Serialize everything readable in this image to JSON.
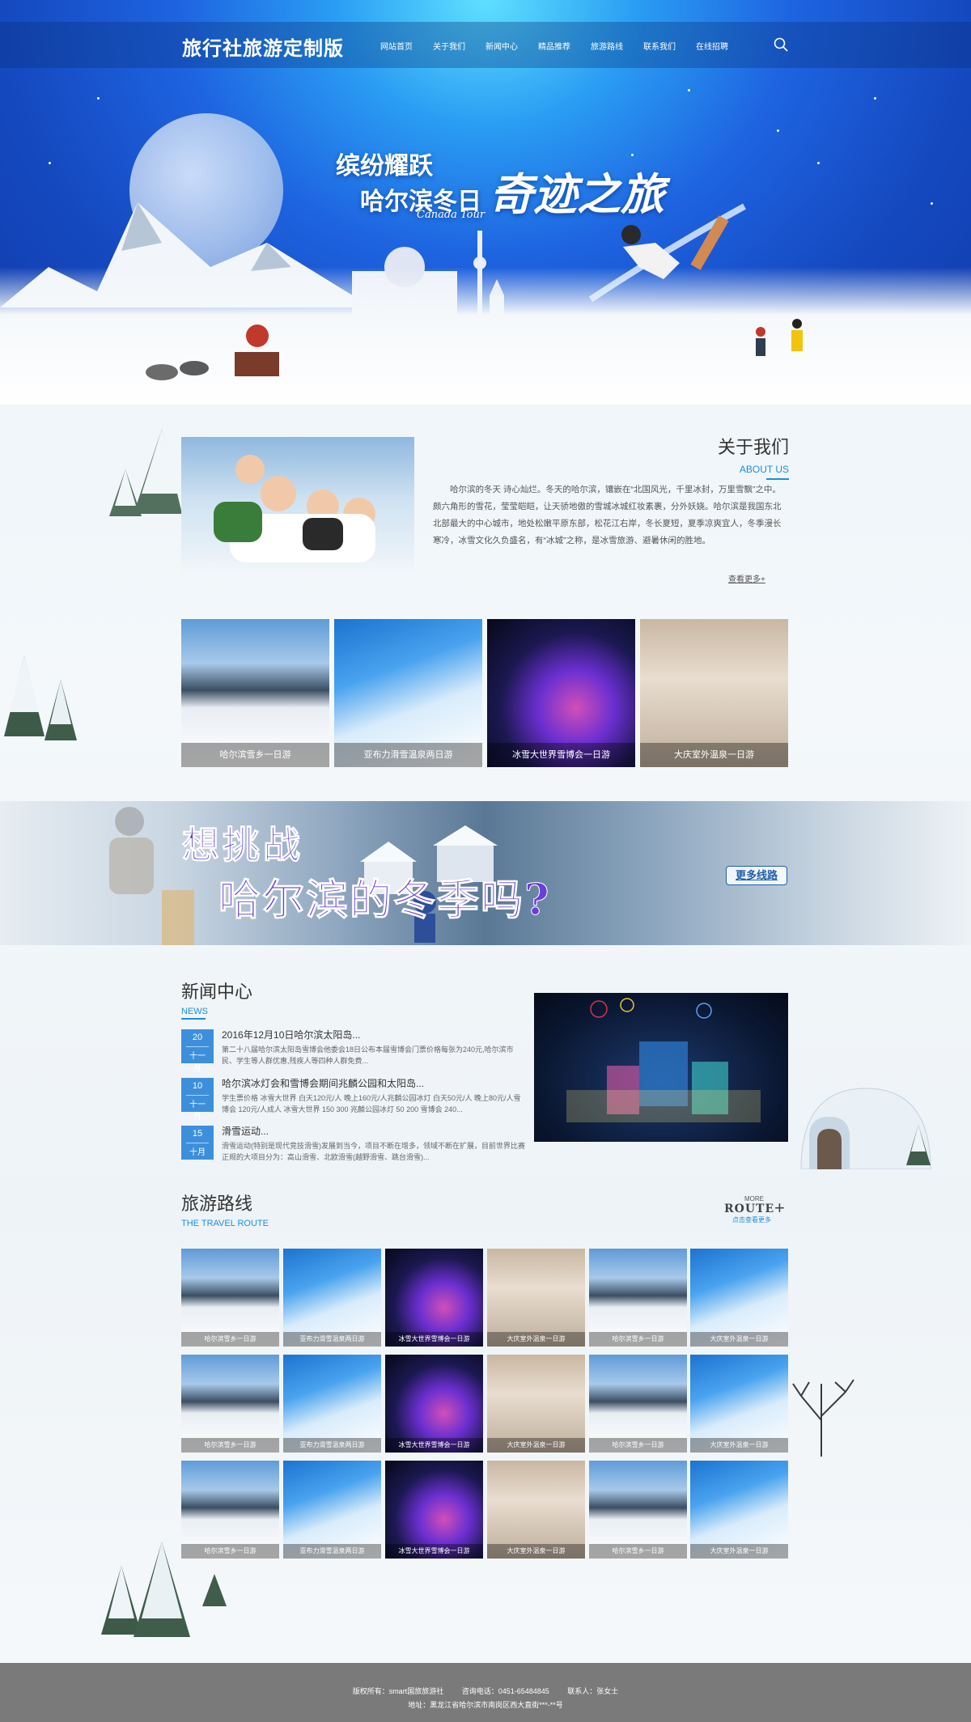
{
  "nav": {
    "brand": "旅行社旅游定制版",
    "items": [
      "网站首页",
      "关于我们",
      "新闻中心",
      "精品推荐",
      "旅游路线",
      "联系我们",
      "在线招聘"
    ]
  },
  "hero": {
    "line1": "缤纷耀跃",
    "line2": "哈尔滨冬日",
    "line3": "奇迹之旅",
    "line4": "Canada Tour"
  },
  "about": {
    "title": "关于我们",
    "subtitle": "ABOUT US",
    "text": "哈尔滨的冬天 诗心灿烂。冬天的哈尔滨，镶嵌在“北国风光，千里冰封，万里雪飘”之中。颇六角形的雪花，莹莹皑皑，让天骄地傲的雪城冰城红妆素裹，分外妖娆。哈尔滨是我国东北北部最大的中心城市，地处松嫩平原东部，松花江右岸，冬长夏短，夏季凉爽宜人，冬季漫长寒冷，冰雪文化久负盛名，有“冰城”之称，是冰雪旅游、避暑休闲的胜地。",
    "more": "查看更多+"
  },
  "features": [
    {
      "label": "哈尔滨雪乡一日游"
    },
    {
      "label": "亚布力滑雪温泉两日游"
    },
    {
      "label": "冰雪大世界雪博会一日游"
    },
    {
      "label": "大庆室外温泉一日游"
    }
  ],
  "banner": {
    "line1": "想挑战",
    "line2": "哈尔滨的冬季吗?",
    "button": "更多线路"
  },
  "news": {
    "title": "新闻中心",
    "subtitle": "NEWS",
    "items": [
      {
        "day": "20",
        "month": "十一月",
        "title": "2016年12月10日哈尔滨太阳岛...",
        "desc": "第二十八届哈尔滨太阳岛雪博会他委会18日公布本届雪博会门票价格每张为240元,哈尔滨市民、学生等人群优惠,残疾人等四种人群免费..."
      },
      {
        "day": "10",
        "month": "十一月",
        "title": "哈尔滨冰灯会和雪博会期间兆麟公园和太阳岛...",
        "desc": "学生票价格 冰雪大世界 白天120元/人 晚上160元/人兆麟公园冰灯 白天50元/人 晚上80元/人雪博会 120元/人成人 冰雪大世界 150 300 兆麟公园冰灯 50 200 雪博会 240..."
      },
      {
        "day": "15",
        "month": "十月",
        "title": "滑雪运动...",
        "desc": "滑雪运动(特别是现代竞技滑雪)发展到当今，项目不断在增多，领域不断在扩展，目前世界比赛正规的大项目分为：高山滑雪、北欧滑雪(越野滑雪、跳台滑雪)..."
      }
    ]
  },
  "route": {
    "title": "旅游路线",
    "subtitle": "THE TRAVEL ROUTE",
    "more_small": "MORE",
    "more_big": "ROUTE",
    "more_sub": "点击查看更多",
    "rows": [
      [
        "哈尔滨雪乡一日游",
        "亚布力滑雪温泉两日游",
        "冰雪大世界雪博会一日游",
        "大庆室外温泉一日游",
        "哈尔滨雪乡一日游",
        "大庆室外温泉一日游"
      ],
      [
        "哈尔滨雪乡一日游",
        "亚布力滑雪温泉两日游",
        "冰雪大世界雪博会一日游",
        "大庆室外温泉一日游",
        "哈尔滨雪乡一日游",
        "大庆室外温泉一日游"
      ],
      [
        "哈尔滨雪乡一日游",
        "亚布力滑雪温泉两日游",
        "冰雪大世界雪博会一日游",
        "大庆室外温泉一日游",
        "哈尔滨雪乡一日游",
        "大庆室外温泉一日游"
      ]
    ]
  },
  "footer": {
    "copyright": "版权所有：smart国旅旅游社",
    "phone": "咨询电话：0451-65484845",
    "contact": "联系人：张女士",
    "address": "地址：黑龙江省哈尔滨市南岗区西大直街***-**号"
  },
  "colors": {
    "accent": "#1a8fe0",
    "date_badge": "#3d8fdc",
    "footer_bg": "#7a7a7a"
  },
  "icons": [
    "search-icon"
  ]
}
